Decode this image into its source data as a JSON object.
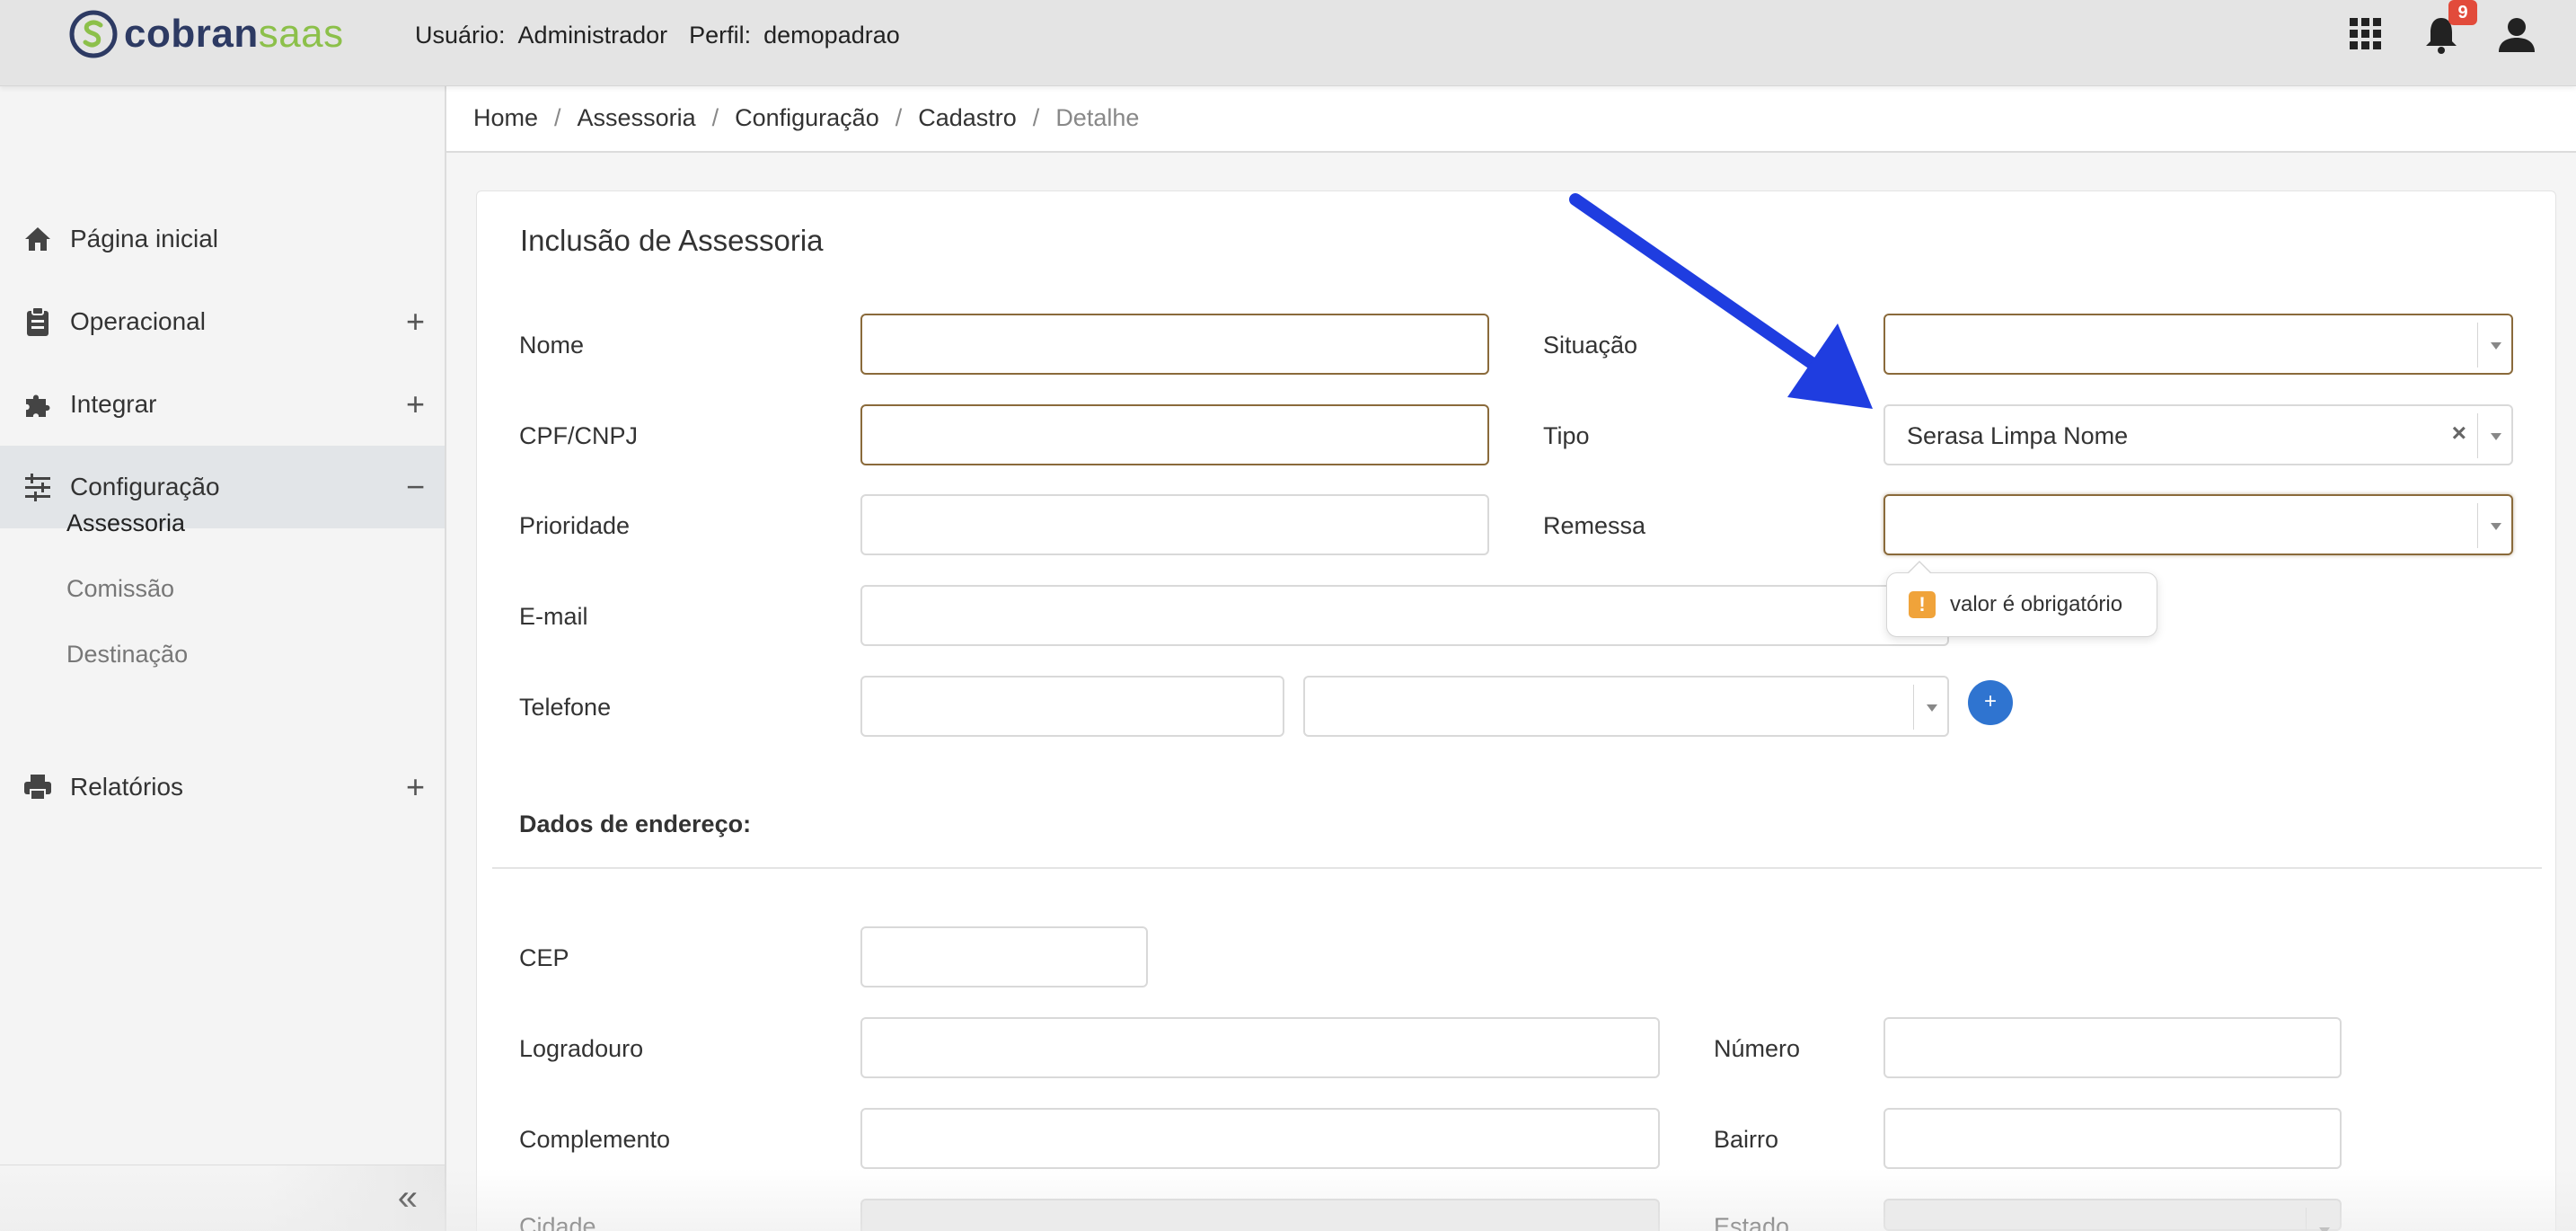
{
  "header": {
    "logo_part1": "cobran",
    "logo_part2": "saas",
    "user_label": "Usuário:",
    "user_value": "Administrador",
    "profile_label": "Perfil:",
    "profile_value": "demopadrao",
    "notification_count": "9",
    "icons": [
      "apps-grid-icon",
      "bell-icon",
      "user-icon"
    ]
  },
  "sidebar": {
    "items": [
      {
        "label": "Página inicial",
        "icon": "home-icon",
        "toggle": ""
      },
      {
        "label": "Operacional",
        "icon": "clipboard-icon",
        "toggle": "+"
      },
      {
        "label": "Integrar",
        "icon": "puzzle-icon",
        "toggle": "+"
      },
      {
        "label": "Configuração",
        "icon": "sliders-icon",
        "toggle": "−"
      },
      {
        "label": "Relatórios",
        "icon": "printer-icon",
        "toggle": "+"
      }
    ],
    "submenu": [
      "Assessoria",
      "Comissão",
      "Destinação"
    ],
    "collapse_glyph": "«"
  },
  "breadcrumb": {
    "items": [
      "Home",
      "Assessoria",
      "Configuração",
      "Cadastro",
      "Detalhe"
    ],
    "separator": "/"
  },
  "form": {
    "title": "Inclusão de Assessoria",
    "labels": {
      "nome": "Nome",
      "situacao": "Situação",
      "cpf": "CPF/CNPJ",
      "tipo": "Tipo",
      "prioridade": "Prioridade",
      "remessa": "Remessa",
      "email": "E-mail",
      "telefone": "Telefone",
      "cep": "CEP",
      "logradouro": "Logradouro",
      "numero": "Número",
      "complemento": "Complemento",
      "bairro": "Bairro",
      "cidade": "Cidade",
      "estado": "Estado"
    },
    "tipo_value": "Serasa Limpa Nome",
    "clear_glyph": "×",
    "validation_message": "valor é obrigatório",
    "warn_glyph": "!",
    "add_phone_glyph": "+",
    "address_section_title": "Dados de endereço:"
  },
  "colors": {
    "brand_dark": "#2d3a63",
    "brand_green": "#8cc04a",
    "required_border": "#8a6a3b",
    "add_button": "#2f74d0",
    "warning": "#f0a33a",
    "annotation_arrow": "#1f3de0"
  }
}
